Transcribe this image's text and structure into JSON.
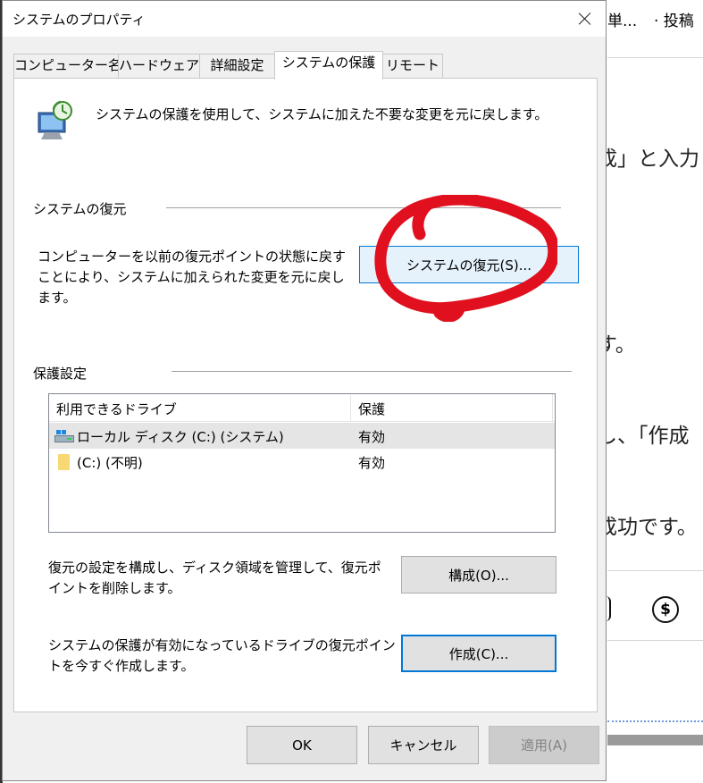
{
  "background": {
    "topbar_left": "単...",
    "topbar_right": "· 投稿",
    "lines": [
      "成」と入力",
      "す。",
      "し、「作成",
      "成功です。"
    ]
  },
  "dialog": {
    "title": "システムのプロパティ",
    "tabs": [
      {
        "label": "コンピューター名"
      },
      {
        "label": "ハードウェア"
      },
      {
        "label": "詳細設定"
      },
      {
        "label": "システムの保護",
        "active": true
      },
      {
        "label": "リモート"
      }
    ],
    "intro": "システムの保護を使用して、システムに加えた不要な変更を元に戻します。",
    "restore": {
      "group_label": "システムの復元",
      "description": "コンピューターを以前の復元ポイントの状態に戻すことにより、システムに加えられた変更を元に戻します。",
      "button_label": "システムの復元(S)..."
    },
    "protection": {
      "group_label": "保護設定",
      "columns": [
        "利用できるドライブ",
        "保護"
      ],
      "rows": [
        {
          "drive": "ローカル ディスク (C:) (システム)",
          "status": "有効",
          "icon": "drive-icon"
        },
        {
          "drive": "(C:) (不明)",
          "status": "有効",
          "icon": "folder-icon"
        }
      ],
      "configure_desc": "復元の設定を構成し、ディスク領域を管理して、復元ポイントを削除します。",
      "configure_label": "構成(O)...",
      "create_desc": "システムの保護が有効になっているドライブの復元ポイントを今すぐ作成します。",
      "create_label": "作成(C)..."
    },
    "footer": {
      "ok": "OK",
      "cancel": "キャンセル",
      "apply": "適用(A)"
    },
    "annotation_color": "#e0101f"
  }
}
